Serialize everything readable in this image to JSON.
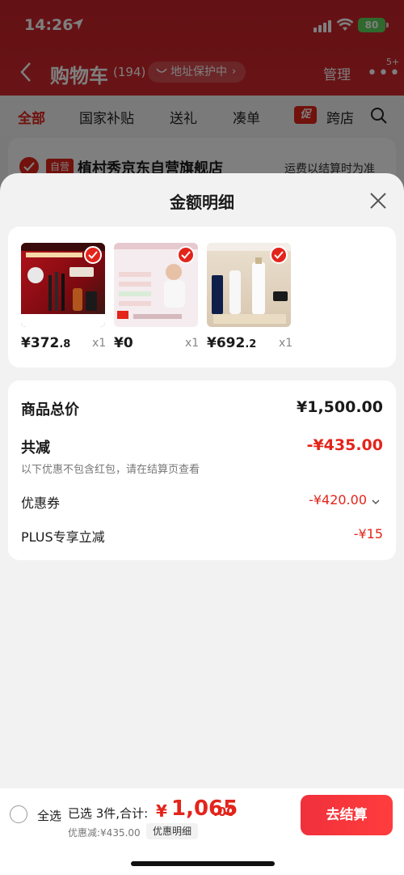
{
  "status_bar": {
    "time": "14:26",
    "battery": "80"
  },
  "nav": {
    "title": "购物车",
    "count": "(194)",
    "address_protect": "地址保护中",
    "manage": "管理",
    "more_badge": "5+"
  },
  "tabs": [
    {
      "label": "全部"
    },
    {
      "label": "国家补贴"
    },
    {
      "label": "送礼"
    },
    {
      "label": "凑单"
    },
    {
      "label": "跨店"
    }
  ],
  "tab_badge": "促",
  "store": {
    "tag": "自营",
    "name": "植村秀京东自营旗舰店",
    "shipping_note": "运费以结算时为准"
  },
  "sheet": {
    "title": "金额明细",
    "items": [
      {
        "price_int": "¥372",
        "price_dec": ".8",
        "qty": "x1"
      },
      {
        "price_int": "¥0",
        "price_dec": "",
        "qty": "x1"
      },
      {
        "price_int": "¥692",
        "price_dec": ".2",
        "qty": "x1"
      }
    ],
    "summary": {
      "total_label": "商品总价",
      "total_value": "¥1,500.00",
      "reduce_label": "共减",
      "reduce_value": "-¥435.00",
      "reduce_note": "以下优惠不包含红包，请在结算页查看",
      "coupon_label": "优惠券",
      "coupon_value": "-¥420.00",
      "plus_label": "PLUS专享立减",
      "plus_value": "-¥15"
    }
  },
  "bottom": {
    "select_all": "全选",
    "selected_text": "已选 3件,合计:",
    "total_symbol": "¥",
    "total_int": "1,065",
    "total_dec": ".00",
    "discount_text": "优惠减:¥435.00",
    "detail_button": "优惠明细",
    "checkout": "去结算"
  },
  "colors": {
    "brand_red": "#e3241b",
    "header_red": "#c8222a"
  }
}
